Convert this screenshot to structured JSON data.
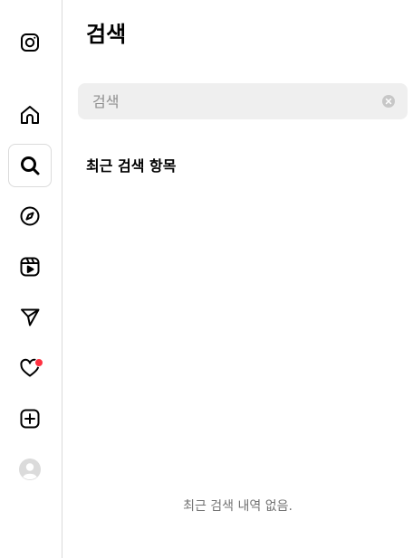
{
  "nav": {
    "items": [
      {
        "icon": "instagram-logo-icon"
      },
      {
        "icon": "home-icon"
      },
      {
        "icon": "search-icon",
        "active": true
      },
      {
        "icon": "compass-icon"
      },
      {
        "icon": "reels-icon"
      },
      {
        "icon": "send-icon"
      },
      {
        "icon": "heart-icon",
        "badge": true
      },
      {
        "icon": "plus-square-icon"
      },
      {
        "icon": "avatar"
      }
    ]
  },
  "search_panel": {
    "title": "검색",
    "placeholder": "검색",
    "value": "",
    "recent_heading": "최근 검색 항목",
    "empty_message": "최근 검색 내역 없음."
  },
  "colors": {
    "border": "#dbdbdb",
    "search_bg": "#efefef",
    "muted_text": "#737373",
    "placeholder": "#8e8e8e",
    "notification": "#ff3040"
  }
}
